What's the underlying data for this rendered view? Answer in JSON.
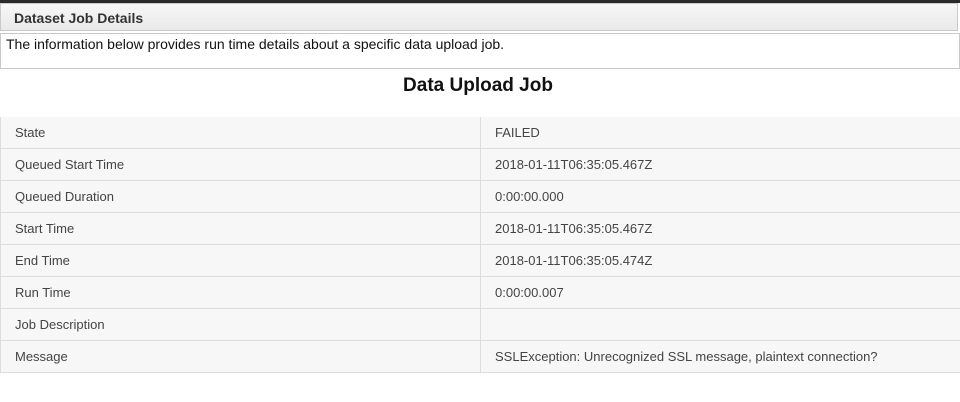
{
  "panel": {
    "title": "Dataset Job Details",
    "description": "The information below provides run time details about a specific data upload job."
  },
  "job": {
    "title": "Data Upload Job",
    "rows": [
      {
        "label": "State",
        "value": "FAILED"
      },
      {
        "label": "Queued Start Time",
        "value": "2018-01-11T06:35:05.467Z"
      },
      {
        "label": "Queued Duration",
        "value": "0:00:00.000"
      },
      {
        "label": "Start Time",
        "value": "2018-01-11T06:35:05.467Z"
      },
      {
        "label": "End Time",
        "value": "2018-01-11T06:35:05.474Z"
      },
      {
        "label": "Run Time",
        "value": "0:00:00.007"
      },
      {
        "label": "Job Description",
        "value": ""
      },
      {
        "label": "Message",
        "value": "SSLException: Unrecognized SSL message, plaintext connection?"
      }
    ]
  }
}
